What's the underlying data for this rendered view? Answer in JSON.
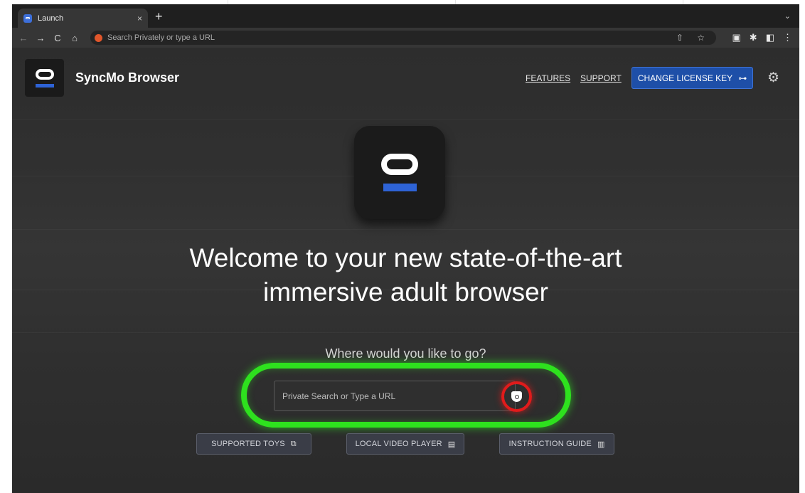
{
  "browser": {
    "tab_title": "Launch",
    "tab_close": "×",
    "new_tab": "+",
    "tab_menu": "⌄",
    "omnibox_placeholder": "Search Privately or type a URL",
    "nav": {
      "back": "←",
      "forward": "→",
      "reload": "C",
      "home": "⌂"
    },
    "omni_icons": "⇧ ☆",
    "toolbar_icons": {
      "profile": "▣",
      "extensions": "✱",
      "sidebar": "◧",
      "menu": "⋮"
    }
  },
  "header": {
    "brand": "SyncMo Browser",
    "links": [
      "FEATURES",
      "SUPPORT"
    ],
    "license_button": "CHANGE LICENSE KEY",
    "key_icon": "key-icon",
    "settings_icon": "gear-icon"
  },
  "hero": {
    "line1": "Welcome to your new state-of-the-art",
    "line2": "immersive adult browser",
    "question": "Where would you like to go?"
  },
  "search": {
    "placeholder": "Private Search or Type a URL",
    "highlight_color": "#2ee11e",
    "button_ring_color": "#e01b1b"
  },
  "actions": [
    {
      "label": "SUPPORTED TOYS",
      "icon": "toys-icon"
    },
    {
      "label": "LOCAL VIDEO PLAYER",
      "icon": "file-icon"
    },
    {
      "label": "INSTRUCTION GUIDE",
      "icon": "book-icon"
    }
  ],
  "colors": {
    "accent": "#1e4fa8",
    "logo_bar": "#2e63d6"
  }
}
